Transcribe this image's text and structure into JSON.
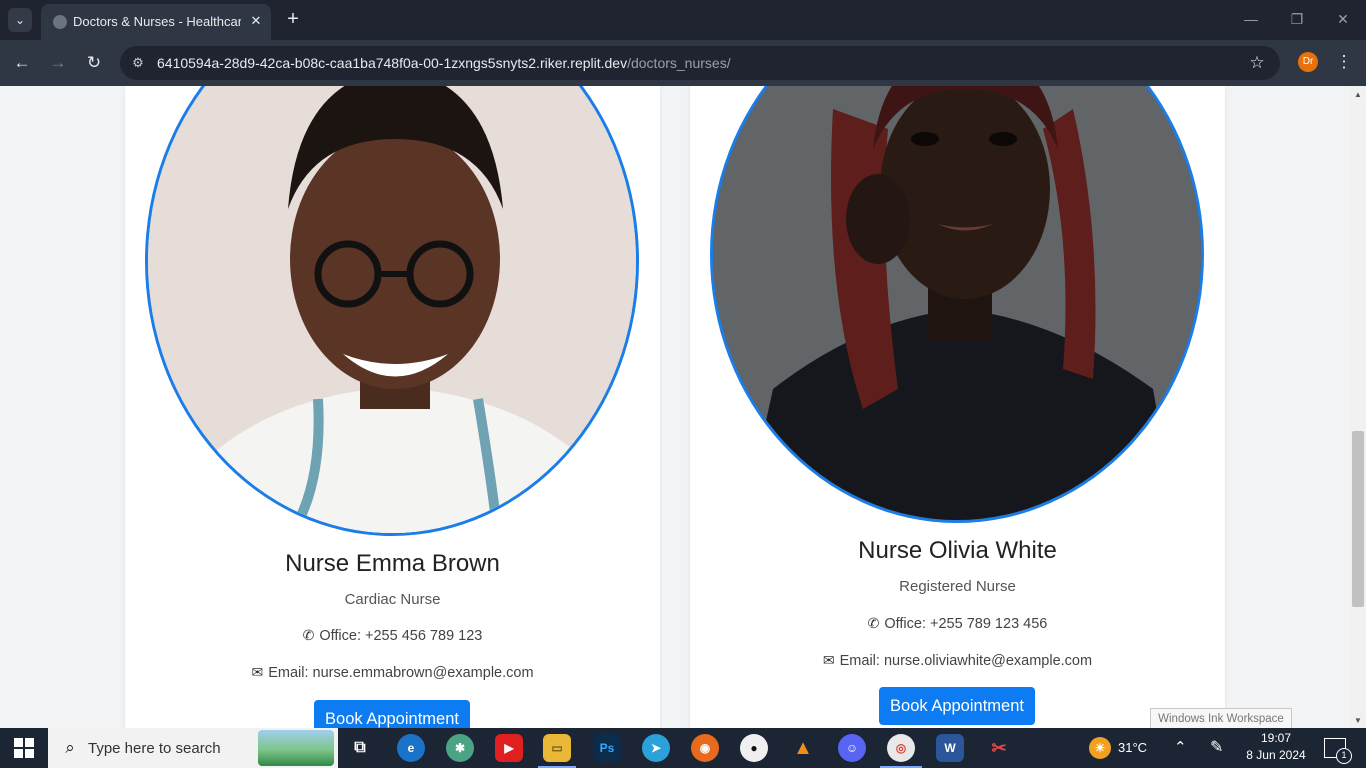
{
  "browser": {
    "tab_title": "Doctors & Nurses - Healthcare",
    "url_host": "6410594a-28d9-42ca-b08c-caa1ba748f0a-00-1zxngs5snyts2.riker.replit.dev",
    "url_path": "/doctors_nurses/",
    "profile_initials": "Dr"
  },
  "nurses": [
    {
      "name": "Nurse Emma Brown",
      "role": "Cardiac Nurse",
      "office": "Office: +255 456 789 123",
      "email": "Email: nurse.emmabrown@example.com",
      "button": "Book Appointment"
    },
    {
      "name": "Nurse Olivia White",
      "role": "Registered Nurse",
      "office": "Office: +255 789 123 456",
      "email": "Email: nurse.oliviawhite@example.com",
      "button": "Book Appointment"
    }
  ],
  "ink_tooltip": "Windows Ink Workspace",
  "taskbar": {
    "search_placeholder": "Type here to search",
    "temperature": "31°C",
    "time": "19:07",
    "date": "8 Jun 2024",
    "notification_count": "1"
  },
  "colors": {
    "accent": "#0d7bf2",
    "photo_border": "#1a7de8"
  }
}
